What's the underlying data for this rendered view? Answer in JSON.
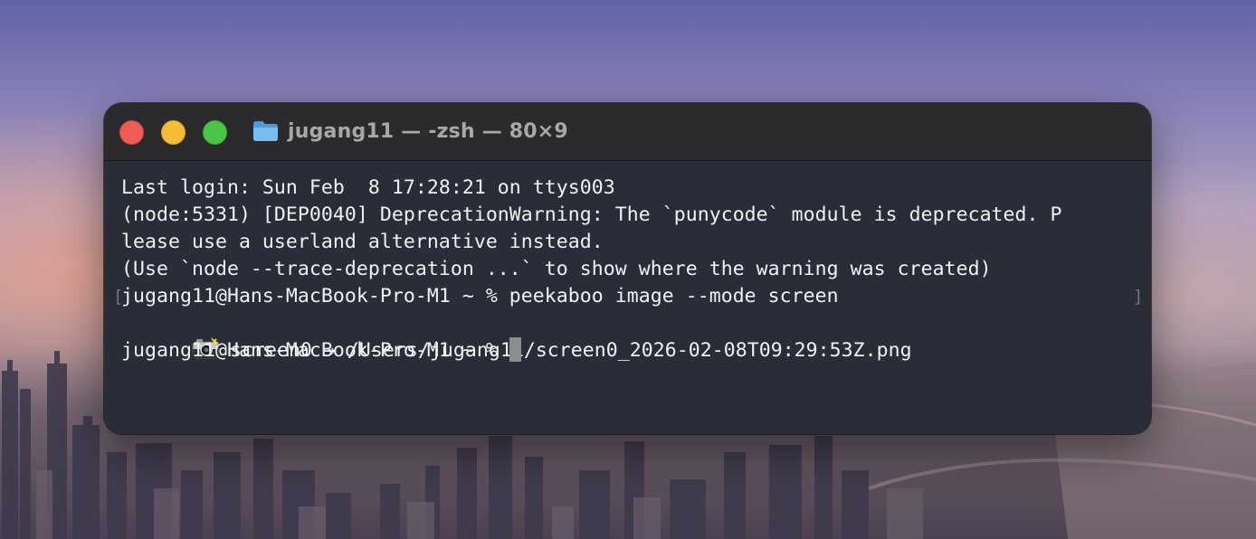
{
  "window": {
    "title": "jugang11 — -zsh — 80×9",
    "controls": {
      "close": "close",
      "minimize": "minimize",
      "zoom": "zoom"
    },
    "title_icon": "folder-icon"
  },
  "terminal": {
    "lines": [
      "Last login: Sun Feb  8 17:28:21 on ttys003",
      "(node:5331) [DEP0040] DeprecationWarning: The `punycode` module is deprecated. P",
      "lease use a userland alternative instead.",
      "(Use `node --trace-deprecation ...` to show where the warning was created)",
      "jugang11@Hans-MacBook-Pro-M1 ~ % peekaboo image --mode screen",
      "screen0 → /Users/jugang11/screen0_2026-02-08T09:29:53Z.png",
      "jugang11@Hans-MacBook-Pro-M1 ~ % "
    ],
    "marks": {
      "left": "[",
      "right": "]"
    },
    "line6_icon": "camera-icon",
    "cursor": "block-cursor"
  },
  "colors": {
    "window_bg": "#282d38",
    "titlebar_bg": "#2b2b2e",
    "text": "#f1f1f1",
    "close": "#ef5c56",
    "minimize": "#f4bd33",
    "zoom": "#49c648"
  }
}
